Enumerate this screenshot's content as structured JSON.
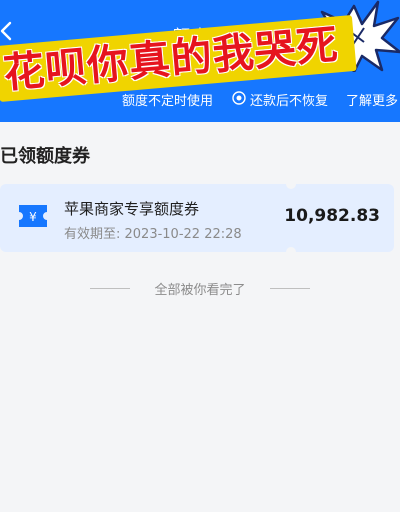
{
  "header": {
    "title": "额度券",
    "meme_caption": "花呗你真的我哭死",
    "features": {
      "item1": "额度不定时使用",
      "item2": "还款后不恢复",
      "learn_more": "了解更多"
    }
  },
  "section": {
    "title": "已领额度券"
  },
  "coupon": {
    "icon_symbol": "¥",
    "name": "苹果商家专享额度券",
    "expiry": "有效期至: 2023-10-22 22:28",
    "amount": "10,982.83"
  },
  "footer": {
    "end_text": "全部被你看完了"
  },
  "colors": {
    "header_blue": "#1677ff",
    "banner_yellow": "#f0d400",
    "caption_red": "#e6141e",
    "coupon_bg": "#e4eeff"
  }
}
